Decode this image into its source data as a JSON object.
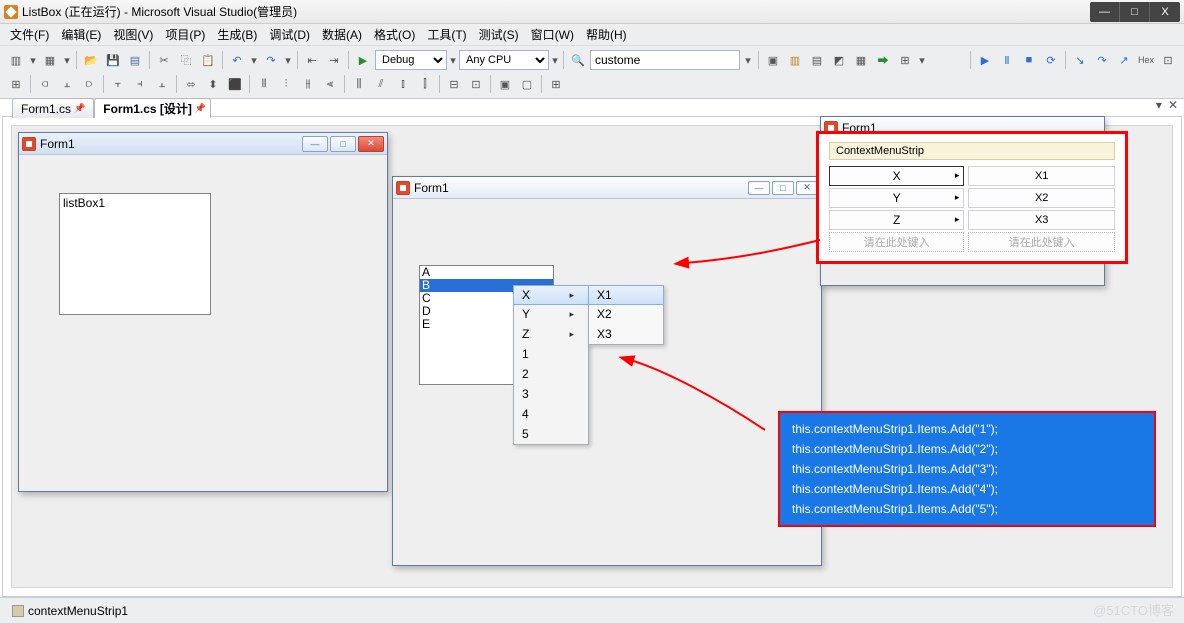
{
  "titlebar": {
    "text": "ListBox (正在运行) - Microsoft Visual Studio(管理员)"
  },
  "winbtns": {
    "min": "—",
    "max": "□",
    "close": "X"
  },
  "menu": [
    "文件(F)",
    "编辑(E)",
    "视图(V)",
    "项目(P)",
    "生成(B)",
    "调试(D)",
    "数据(A)",
    "格式(O)",
    "工具(T)",
    "测试(S)",
    "窗口(W)",
    "帮助(H)"
  ],
  "toolbar1": {
    "config": "Debug",
    "platform": "Any CPU",
    "search": "custome",
    "play": "▶"
  },
  "tabs": {
    "t1": "Form1.cs",
    "t2": "Form1.cs [设计]"
  },
  "form1": {
    "title": "Form1",
    "listboxText": "listBox1"
  },
  "form2": {
    "title": "Form1",
    "items": [
      "A",
      "B",
      "C",
      "D",
      "E"
    ],
    "selected": 1,
    "menu": [
      "X",
      "Y",
      "Z",
      "1",
      "2",
      "3",
      "4",
      "5"
    ],
    "submenu": [
      "X1",
      "X2",
      "X3"
    ]
  },
  "form3": {
    "title": "Form1"
  },
  "cmsDesigner": {
    "header": "ContextMenuStrip",
    "left": [
      "X",
      "Y",
      "Z"
    ],
    "right": [
      "X1",
      "X2",
      "X3"
    ],
    "placeholder": "请在此处键入"
  },
  "code": [
    "this.contextMenuStrip1.Items.Add(\"1\");",
    "this.contextMenuStrip1.Items.Add(\"2\");",
    "this.contextMenuStrip1.Items.Add(\"3\");",
    "this.contextMenuStrip1.Items.Add(\"4\");",
    "this.contextMenuStrip1.Items.Add(\"5\");"
  ],
  "status": {
    "component": "contextMenuStrip1"
  },
  "watermark": "@51CTO博客"
}
